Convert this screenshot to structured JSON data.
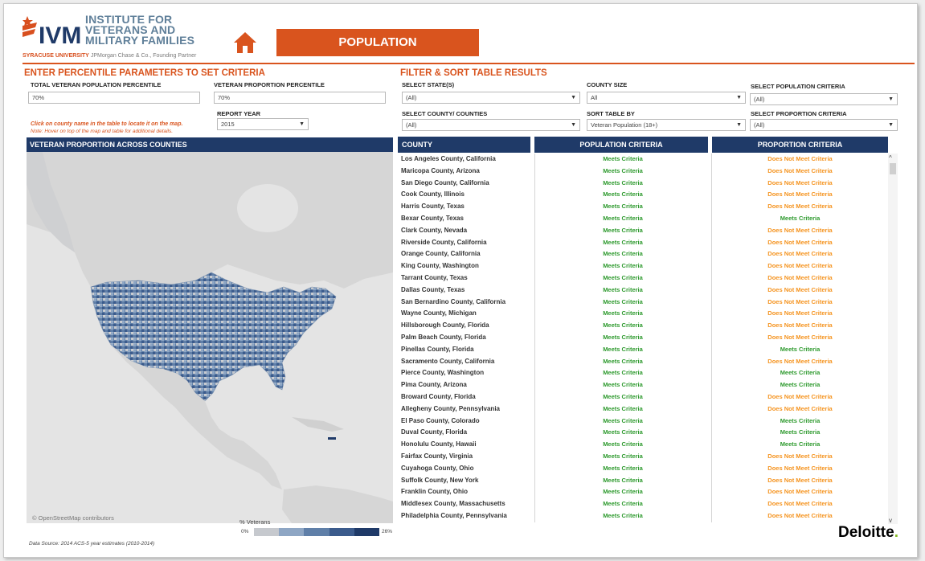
{
  "header": {
    "logo_mark": "IVMF",
    "logo_lines": [
      "INSTITUTE FOR",
      "VETERANS AND",
      "MILITARY FAMILIES"
    ],
    "logo_university": "SYRACUSE UNIVERSITY",
    "logo_partner": "JPMorgan Chase & Co., Founding Partner",
    "home_icon": "home-icon",
    "page_title": "POPULATION"
  },
  "criteria": {
    "section_title": "ENTER PERCENTILE PARAMETERS TO SET CRITERIA",
    "total_pop_label": "TOTAL VETERAN POPULATION PERCENTILE",
    "total_pop_value": "70%",
    "proportion_label": "VETERAN PROPORTION PERCENTILE",
    "proportion_value": "70%",
    "report_year_label": "REPORT YEAR",
    "report_year_value": "2015",
    "note_click": "Click on county name in the table to locate it on the map.",
    "note_hover": "Note: Hover on top of the map and table for additional details."
  },
  "filter": {
    "section_title": "FILTER & SORT TABLE RESULTS",
    "state_label": "SELECT STATE(S)",
    "state_value": "(All)",
    "county_size_label": "COUNTY SIZE",
    "county_size_value": "All",
    "pop_criteria_label": "SELECT POPULATION CRITERIA",
    "pop_criteria_value": "(All)",
    "counties_label": "SELECT COUNTY/ COUNTIES",
    "counties_value": "(All)",
    "sort_label": "SORT TABLE BY",
    "sort_value": "Veteran Population (18+)",
    "prop_criteria_label": "SELECT PROPORTION CRITERIA",
    "prop_criteria_value": "(All)"
  },
  "map": {
    "title": "VETERAN PROPORTION ACROSS COUNTIES",
    "attribution": "© OpenStreetMap contributors",
    "legend_title": "% Veterans",
    "legend_min": "0%",
    "legend_max": "26%",
    "legend_colors": [
      "#c6c9ce",
      "#8ea6c4",
      "#5f7fa8",
      "#3b5b8c",
      "#1f3a68"
    ],
    "land_color": "#d6d6d6",
    "water_color": "#e4e4e4"
  },
  "table": {
    "headers": [
      "COUNTY",
      "POPULATION CRITERIA",
      "PROPORTION CRITERIA"
    ],
    "meets_color": "#2e9a2e",
    "not_meets_color": "#f5931e",
    "rows": [
      {
        "county": "Los Angeles County, California",
        "pop": "Meets Criteria",
        "prop": "Does Not Meet Criteria"
      },
      {
        "county": "Maricopa County, Arizona",
        "pop": "Meets Criteria",
        "prop": "Does Not Meet Criteria"
      },
      {
        "county": "San Diego County, California",
        "pop": "Meets Criteria",
        "prop": "Does Not Meet Criteria"
      },
      {
        "county": "Cook County, Illinois",
        "pop": "Meets Criteria",
        "prop": "Does Not Meet Criteria"
      },
      {
        "county": "Harris County, Texas",
        "pop": "Meets Criteria",
        "prop": "Does Not Meet Criteria"
      },
      {
        "county": "Bexar County, Texas",
        "pop": "Meets Criteria",
        "prop": "Meets Criteria"
      },
      {
        "county": "Clark County, Nevada",
        "pop": "Meets Criteria",
        "prop": "Does Not Meet Criteria"
      },
      {
        "county": "Riverside County, California",
        "pop": "Meets Criteria",
        "prop": "Does Not Meet Criteria"
      },
      {
        "county": "Orange County, California",
        "pop": "Meets Criteria",
        "prop": "Does Not Meet Criteria"
      },
      {
        "county": "King County, Washington",
        "pop": "Meets Criteria",
        "prop": "Does Not Meet Criteria"
      },
      {
        "county": "Tarrant County, Texas",
        "pop": "Meets Criteria",
        "prop": "Does Not Meet Criteria"
      },
      {
        "county": "Dallas County, Texas",
        "pop": "Meets Criteria",
        "prop": "Does Not Meet Criteria"
      },
      {
        "county": "San Bernardino County, California",
        "pop": "Meets Criteria",
        "prop": "Does Not Meet Criteria"
      },
      {
        "county": "Wayne County, Michigan",
        "pop": "Meets Criteria",
        "prop": "Does Not Meet Criteria"
      },
      {
        "county": "Hillsborough County, Florida",
        "pop": "Meets Criteria",
        "prop": "Does Not Meet Criteria"
      },
      {
        "county": "Palm Beach County, Florida",
        "pop": "Meets Criteria",
        "prop": "Does Not Meet Criteria"
      },
      {
        "county": "Pinellas County, Florida",
        "pop": "Meets Criteria",
        "prop": "Meets Criteria"
      },
      {
        "county": "Sacramento County, California",
        "pop": "Meets Criteria",
        "prop": "Does Not Meet Criteria"
      },
      {
        "county": "Pierce County, Washington",
        "pop": "Meets Criteria",
        "prop": "Meets Criteria"
      },
      {
        "county": "Pima County, Arizona",
        "pop": "Meets Criteria",
        "prop": "Meets Criteria"
      },
      {
        "county": "Broward County, Florida",
        "pop": "Meets Criteria",
        "prop": "Does Not Meet Criteria"
      },
      {
        "county": "Allegheny County, Pennsylvania",
        "pop": "Meets Criteria",
        "prop": "Does Not Meet Criteria"
      },
      {
        "county": "El Paso County, Colorado",
        "pop": "Meets Criteria",
        "prop": "Meets Criteria"
      },
      {
        "county": "Duval County, Florida",
        "pop": "Meets Criteria",
        "prop": "Meets Criteria"
      },
      {
        "county": "Honolulu County, Hawaii",
        "pop": "Meets Criteria",
        "prop": "Meets Criteria"
      },
      {
        "county": "Fairfax County, Virginia",
        "pop": "Meets Criteria",
        "prop": "Does Not Meet Criteria"
      },
      {
        "county": "Cuyahoga County, Ohio",
        "pop": "Meets Criteria",
        "prop": "Does Not Meet Criteria"
      },
      {
        "county": "Suffolk County, New York",
        "pop": "Meets Criteria",
        "prop": "Does Not Meet Criteria"
      },
      {
        "county": "Franklin County, Ohio",
        "pop": "Meets Criteria",
        "prop": "Does Not Meet Criteria"
      },
      {
        "county": "Middlesex County, Massachusetts",
        "pop": "Meets Criteria",
        "prop": "Does Not Meet Criteria"
      },
      {
        "county": "Philadelphia County, Pennsylvania",
        "pop": "Meets Criteria",
        "prop": "Does Not Meet Criteria"
      }
    ],
    "scroll_up_icon": "scroll-up-icon",
    "scroll_down_icon": "scroll-down-icon"
  },
  "footer": {
    "source": "Data Source: 2014 ACS-5 year estimates (2010-2014)",
    "brand": "Deloitte",
    "brand_dot": "."
  }
}
